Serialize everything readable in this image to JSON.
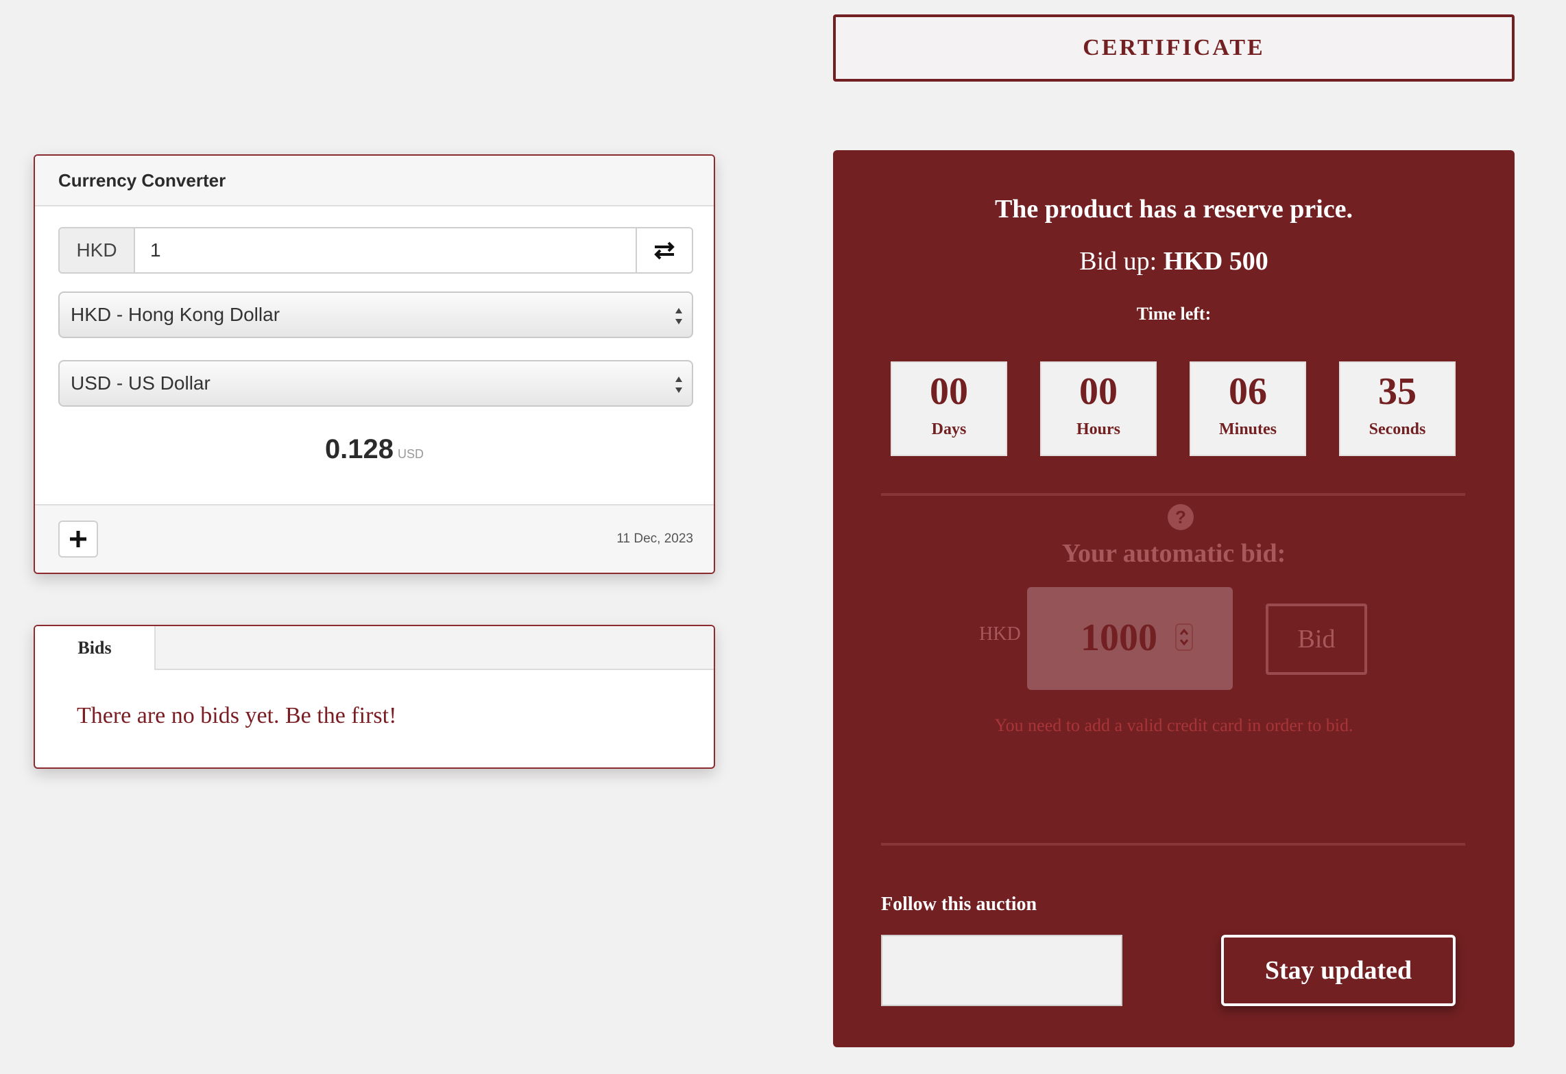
{
  "certificate": {
    "label": "CERTIFICATE"
  },
  "converter": {
    "title": "Currency Converter",
    "amount_currency": "HKD",
    "amount_value": "1",
    "from_select": "HKD - Hong Kong Dollar",
    "to_select": "USD - US Dollar",
    "result_value": "0.128",
    "result_unit": "USD",
    "date": "11 Dec, 2023",
    "icons": {
      "swap": "swap-icon",
      "add": "plus-icon",
      "select_arrows": "select-arrows-icon"
    }
  },
  "bids": {
    "tab_label": "Bids",
    "empty_message": "There are no bids yet. Be the first!"
  },
  "auction": {
    "reserve_message": "The product has a reserve price.",
    "bid_up_label": "Bid up:",
    "bid_up_value": "HKD 500",
    "time_left_label": "Time left:",
    "countdown": [
      {
        "value": "00",
        "label": "Days"
      },
      {
        "value": "00",
        "label": "Hours"
      },
      {
        "value": "06",
        "label": "Minutes"
      },
      {
        "value": "35",
        "label": "Seconds"
      }
    ],
    "help_symbol": "?",
    "auto_bid_label": "Your automatic bid:",
    "bid_currency": "HKD",
    "bid_amount": "1000",
    "bid_button": "Bid",
    "card_warning": "You need to add a valid credit card in order to bid.",
    "follow_label": "Follow this auction",
    "follow_input_value": "",
    "stay_updated_button": "Stay updated"
  },
  "colors": {
    "brand": "#722022",
    "background": "#f2f1f1",
    "warning": "#a73539"
  }
}
